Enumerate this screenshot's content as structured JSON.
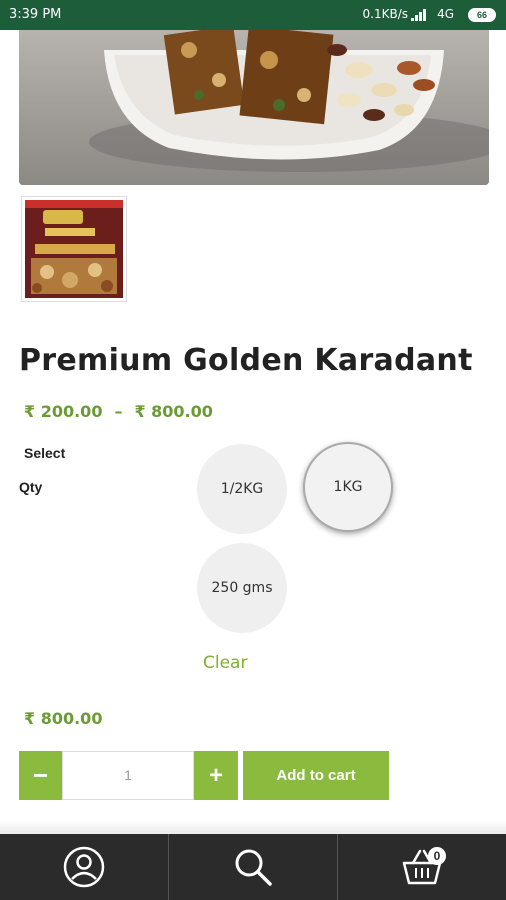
{
  "status_bar": {
    "time": "3:39 PM",
    "network_speed": "0.1KB/s",
    "network_type": "4G",
    "battery": "66"
  },
  "product": {
    "title": "Premium Golden Karadant",
    "price_min": "₹ 200.00",
    "price_separator": "–",
    "price_max": "₹ 800.00"
  },
  "variation": {
    "select_label": "Select",
    "qty_label": "Qty",
    "options": [
      {
        "label": "1/2KG",
        "selected": false
      },
      {
        "label": "1KG",
        "selected": true
      },
      {
        "label": "250 gms",
        "selected": false
      }
    ],
    "clear_label": "Clear"
  },
  "current_price": "₹ 800.00",
  "cart_controls": {
    "minus_label": "−",
    "quantity": "1",
    "plus_label": "+",
    "add_to_cart_label": "Add to cart"
  },
  "bottom_nav": {
    "items": [
      {
        "icon": "account-icon"
      },
      {
        "icon": "search-icon"
      },
      {
        "icon": "cart-icon"
      }
    ],
    "cart_count": "0"
  },
  "colors": {
    "status_bar": "#1e5d3a",
    "accent_green": "#8bbb3e",
    "price_green": "#6b9c34",
    "nav_bg": "#2b2b2b"
  }
}
